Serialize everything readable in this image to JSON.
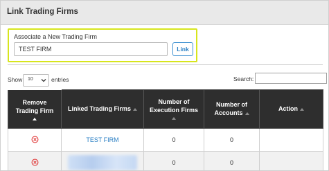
{
  "panel": {
    "title": "Link Trading Firms"
  },
  "associate": {
    "label": "Associate a New Trading Firm",
    "input_value": "TEST FIRM",
    "link_button": "Link"
  },
  "controls": {
    "show_label": "Show",
    "entries_value": "10",
    "entries_label": "entries",
    "search_label": "Search:",
    "search_value": ""
  },
  "table": {
    "columns": [
      "Remove Trading Firm",
      "Linked Trading Firms",
      "Number of Execution Firms",
      "Number of Accounts",
      "Action"
    ],
    "rows": [
      {
        "firm": "TEST FIRM",
        "execution_firms": "0",
        "accounts": "0",
        "action": ""
      },
      {
        "firm": "",
        "execution_firms": "0",
        "accounts": "0",
        "action": ""
      }
    ]
  },
  "colors": {
    "highlight_border": "#d7e51d",
    "header_bg": "#2e2e2e",
    "link_blue": "#2a7fc4",
    "remove_red": "#e03a3a"
  },
  "icons": [
    "remove-icon",
    "chevron-down-icon",
    "sort-asc-icon"
  ]
}
